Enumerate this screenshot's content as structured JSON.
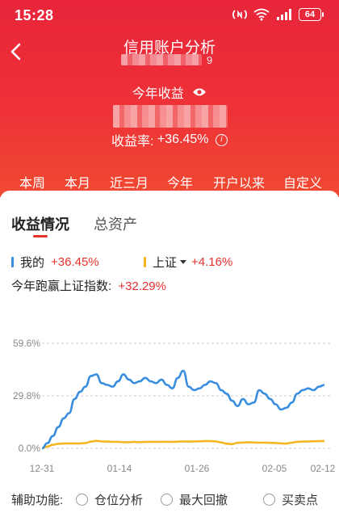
{
  "status_bar": {
    "time": "15:28",
    "battery": "64"
  },
  "header": {
    "title": "信用账户分析",
    "account_suffix": "9",
    "ytd_label": "今年收益",
    "return_rate_label": "收益率:",
    "return_rate_value": "+36.45%"
  },
  "periods": [
    "本周",
    "本月",
    "近三月",
    "今年",
    "开户以来",
    "自定义"
  ],
  "active_period": "今年",
  "tabs": [
    "收益情况",
    "总资产"
  ],
  "legend": {
    "mine_label": "我的",
    "mine_value": "+36.45%",
    "index_label": "上证",
    "index_value": "+4.16%"
  },
  "beat_index": {
    "label": "今年跑赢上证指数:",
    "value": "+32.29%"
  },
  "assist": {
    "label": "辅助功能:",
    "options": [
      "仓位分析",
      "最大回撤",
      "买卖点"
    ]
  },
  "colors": {
    "accent": "#e8322e",
    "mine_line": "#3a8ee0",
    "index_line": "#f5b521"
  },
  "chart_data": {
    "type": "line",
    "y_ticks": [
      "59.6%",
      "29.8%",
      "0.0%"
    ],
    "x_ticks": [
      "12-31",
      "01-14",
      "01-26",
      "02-05",
      "02-12"
    ],
    "ylim": [
      0,
      59.6
    ],
    "series": [
      {
        "name": "我的",
        "color": "#3a8ee0",
        "values": [
          0,
          3,
          7,
          12,
          17,
          20,
          28,
          32,
          35,
          41,
          42,
          37,
          36,
          35,
          38,
          42,
          39,
          37,
          38,
          40,
          38,
          37,
          39,
          36,
          34,
          40,
          44,
          35,
          33,
          34,
          36,
          38,
          37,
          33,
          31,
          27,
          24,
          28,
          25,
          26,
          33,
          31,
          28,
          25,
          22,
          23,
          26,
          31,
          33,
          34,
          33,
          35,
          36
        ]
      },
      {
        "name": "上证",
        "color": "#f5b521",
        "values": [
          0,
          1,
          2,
          2.5,
          2.7,
          2.8,
          2.7,
          2.8,
          3,
          3.8,
          4.2,
          3.9,
          3.8,
          3.7,
          3.6,
          3.5,
          3.5,
          3.6,
          3.5,
          3.6,
          3.7,
          3.6,
          3.7,
          3.7,
          3.6,
          3.8,
          3.9,
          3.8,
          3.9,
          4.0,
          4.1,
          4.1,
          3.9,
          3.3,
          2.6,
          2.4,
          3.1,
          3.3,
          3.4,
          3.3,
          3.2,
          3.2,
          3.1,
          3.0,
          2.8,
          2.7,
          3.2,
          3.7,
          3.8,
          3.9,
          4.0,
          4.1,
          4.16
        ]
      }
    ]
  }
}
